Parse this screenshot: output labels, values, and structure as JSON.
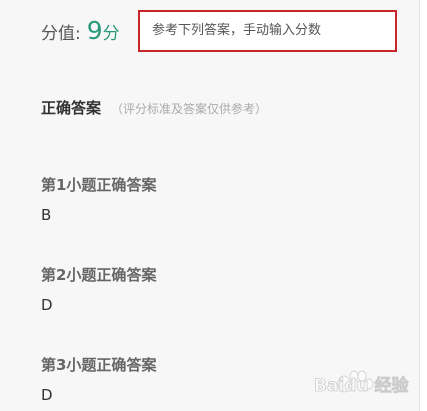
{
  "score": {
    "label": "分值:",
    "value": "9",
    "unit": "分",
    "input_value": "参考下列答案，手动输入分数"
  },
  "answers": {
    "title": "正确答案",
    "note": "（评分标准及答案仅供参考）",
    "questions": [
      {
        "title": "第1小题正确答案",
        "answer": "B"
      },
      {
        "title": "第2小题正确答案",
        "answer": "D"
      },
      {
        "title": "第3小题正确答案",
        "answer": "D"
      }
    ]
  },
  "watermark": {
    "text": "Baidu 经验"
  }
}
